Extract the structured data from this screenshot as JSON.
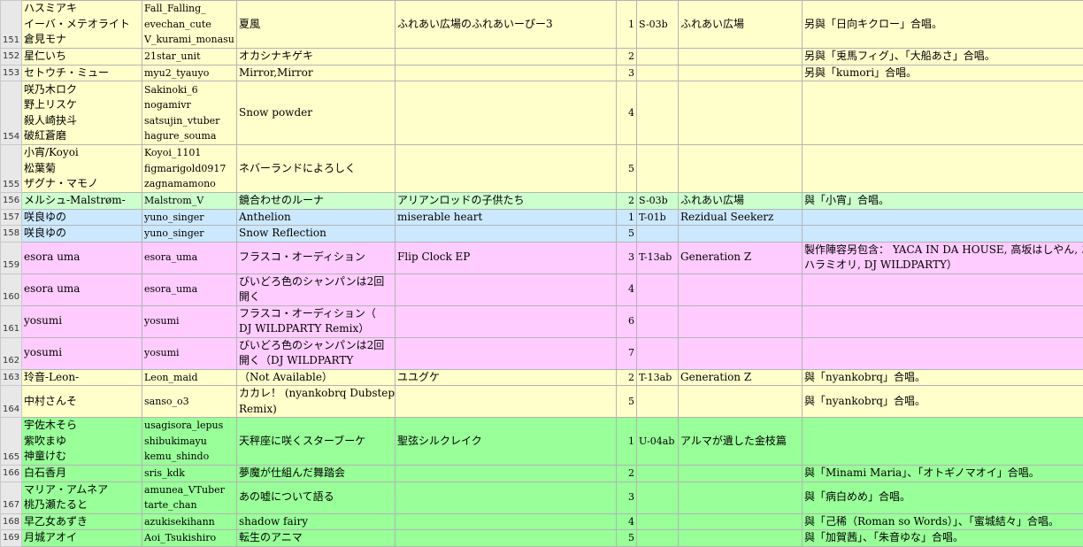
{
  "rows": [
    {
      "n": "151",
      "color": "yellow",
      "a": [
        "ハスミアキ",
        "イーバ・メテオライト",
        "倉見モナ"
      ],
      "b": [
        "Fall_Falling_",
        "evechan_cute",
        "V_kurami_monasu"
      ],
      "c": "夏風",
      "d": "ふれあい広場のふれあいーぴー3",
      "e": "1",
      "f": "S-03b",
      "g": "ふれあい広場",
      "h": "另與「日向キクロー」合唱。"
    },
    {
      "n": "152",
      "color": "yellow",
      "a": [
        "星仁いち"
      ],
      "b": [
        "21star_unit"
      ],
      "c": "オカシナキゲキ",
      "d": "",
      "e": "2",
      "f": "",
      "g": "",
      "h": "另與「兎馬フィグ」、「大船あさ」合唱。"
    },
    {
      "n": "153",
      "color": "yellow",
      "a": [
        "セトウチ・ミュー"
      ],
      "b": [
        "myu2_tyauyo"
      ],
      "c": "Mirror,Mirror",
      "d": "",
      "e": "3",
      "f": "",
      "g": "",
      "h": "另與「kumori」合唱。"
    },
    {
      "n": "154",
      "color": "yellow",
      "a": [
        "咲乃木ロク",
        "野上リスケ",
        "殺人崎抉斗",
        "破紅蒼磨"
      ],
      "b": [
        "Sakinoki_6",
        "nogamivr",
        "satsujin_vtuber",
        "hagure_souma"
      ],
      "c": "Snow powder",
      "d": "",
      "e": "4",
      "f": "",
      "g": "",
      "h": ""
    },
    {
      "n": "155",
      "color": "yellow",
      "a": [
        "小宵/Koyoi",
        "松葉菊",
        "ザグナ・マモノ"
      ],
      "b": [
        "Koyoi_1101",
        "figmarigold0917",
        "zagnamamono"
      ],
      "c": "ネバーランドによろしく",
      "d": "",
      "e": "5",
      "f": "",
      "g": "",
      "h": ""
    },
    {
      "n": "156",
      "color": "green",
      "a": [
        "メルシュ-Malstrøm-"
      ],
      "b": [
        "Malstrom_V"
      ],
      "c": "鏡合わせのルーナ",
      "d": "アリアンロッドの子供たち",
      "e": "2",
      "f": "S-03b",
      "g": "ふれあい広場",
      "h": "與「小宵」合唱。"
    },
    {
      "n": "157",
      "color": "blue",
      "a": [
        "咲良ゆの"
      ],
      "b": [
        "yuno_singer"
      ],
      "c": "Anthelion",
      "d": "miserable heart",
      "e": "1",
      "f": "T-01b",
      "g": "Rezidual Seekerz",
      "h": ""
    },
    {
      "n": "158",
      "color": "blue",
      "a": [
        "咲良ゆの"
      ],
      "b": [
        "yuno_singer"
      ],
      "c": "Snow Reflection",
      "d": "",
      "e": "5",
      "f": "",
      "g": "",
      "h": ""
    },
    {
      "n": "159",
      "color": "pink",
      "a": [
        "esora uma"
      ],
      "b": [
        "esora_uma"
      ],
      "c": "フラスコ・オーディション",
      "d": "Flip Clock EP",
      "e": "3",
      "f": "T-13ab",
      "g": "Generation Z",
      "h": [
        "製作陣容另包含： YACA IN DA HOUSE, 高坂はしやん, エ",
        "ハラミオリ, DJ WILDPARTY）"
      ]
    },
    {
      "n": "160",
      "color": "pink",
      "a": [
        "esora uma"
      ],
      "b": [
        "esora_uma"
      ],
      "c": [
        "びいどろ色のシャンパンは2回",
        "開く"
      ],
      "d": "",
      "e": "4",
      "f": "",
      "g": "",
      "h": ""
    },
    {
      "n": "161",
      "color": "pink",
      "a": [
        "yosumi"
      ],
      "b": [
        "yosumi"
      ],
      "c": [
        "フラスコ・オーディション（",
        "DJ WILDPARTY Remix）"
      ],
      "d": "",
      "e": "6",
      "f": "",
      "g": "",
      "h": ""
    },
    {
      "n": "162",
      "color": "pink",
      "a": [
        "yosumi"
      ],
      "b": [
        "yosumi"
      ],
      "c": [
        "びいどろ色のシャンパンは2回",
        "開く（DJ WILDPARTY"
      ],
      "d": "",
      "e": "7",
      "f": "",
      "g": "",
      "h": ""
    },
    {
      "n": "163",
      "color": "yellow",
      "a": [
        "玲音-Leon-"
      ],
      "b": [
        "Leon_maid"
      ],
      "c": "（Not Available）",
      "d": "ユユグケ",
      "e": "2",
      "f": "T-13ab",
      "g": "Generation Z",
      "h": "與「nyankobrq」合唱。"
    },
    {
      "n": "164",
      "color": "yellow",
      "a": [
        "中村さんそ"
      ],
      "b": [
        "sanso_o3"
      ],
      "c": [
        "カカレ！ (nyankobrq Dubstep",
        "Remix)"
      ],
      "d": "",
      "e": "5",
      "f": "",
      "g": "",
      "h": "與「nyankobrq」合唱。"
    },
    {
      "n": "165",
      "color": "lgreen",
      "a": [
        "宇佐木そら",
        "紫吹まゆ",
        "神童けむ"
      ],
      "b": [
        "usagisora_lepus",
        "shibukimayu",
        "kemu_shindo"
      ],
      "c": "天秤座に咲くスターブーケ",
      "d": "聖弦シルクレイク",
      "e": "1",
      "f": "U-04ab",
      "g": "アルマが遺した金枝篇",
      "h": ""
    },
    {
      "n": "166",
      "color": "lgreen",
      "a": [
        "白石香月"
      ],
      "b": [
        "sris_kdk"
      ],
      "c": "夢魔が仕組んだ舞踏会",
      "d": "",
      "e": "2",
      "f": "",
      "g": "",
      "h": "與「Minami Maria」、「オトギノマオイ」合唱。"
    },
    {
      "n": "167",
      "color": "lgreen",
      "a": [
        "マリア・アムネア",
        "桃乃瀬たると"
      ],
      "b": [
        "amunea_VTuber",
        "tarte_chan"
      ],
      "c": "あの嘘について語る",
      "d": "",
      "e": "3",
      "f": "",
      "g": "",
      "h": "與「病白めめ」合唱。"
    },
    {
      "n": "168",
      "color": "lgreen",
      "a": [
        "早乙女あずき"
      ],
      "b": [
        "azukisekihann"
      ],
      "c": "shadow fairy",
      "d": "",
      "e": "4",
      "f": "",
      "g": "",
      "h": "與「己稀（Roman so Words）」、「蜜城結々」合唱。"
    },
    {
      "n": "169",
      "color": "lgreen",
      "a": [
        "月城アオイ"
      ],
      "b": [
        "Aoi_Tsukishiro"
      ],
      "c": "転生のアニマ",
      "d": "",
      "e": "5",
      "f": "",
      "g": "",
      "h": "與「加賀茜」、「朱音ゆな」合唱。"
    }
  ]
}
